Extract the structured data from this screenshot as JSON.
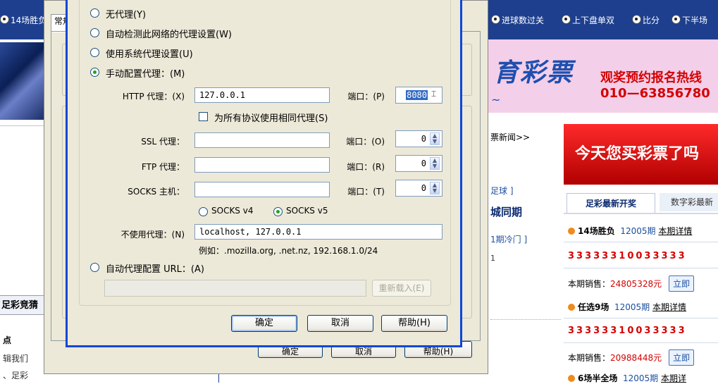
{
  "background_page": {
    "top_nav": [
      {
        "label": "14场胜负"
      },
      {
        "label": "进球数过关"
      },
      {
        "label": "上下盘单双"
      },
      {
        "label": "比分"
      },
      {
        "label": "下半场"
      }
    ],
    "banner": {
      "title": "育彩票",
      "promo": "观奖预约报名热线",
      "phone": "010—63856780",
      "tilde": "~"
    },
    "red_banner_text": "今天您买彩票了吗",
    "news": {
      "more_link": "票新闻>>",
      "tag": "足球 ]",
      "headline": "城同期",
      "tag2": "1期冷门 ]",
      "one": "1"
    },
    "left_column": {
      "heading": "足彩竞猜",
      "sub": "点",
      "text1": "辑我们",
      "text2": "、足彩"
    },
    "lottery_panel": {
      "tab_active": "足彩最新开奖",
      "tab_other": "数字彩最新",
      "items": [
        {
          "name": "14场胜负",
          "period": "12005期",
          "detail": "本期详情",
          "numbers": "33333310033333",
          "sales_label": "本期销售：",
          "sales_value": "24805328元",
          "buy": "立即"
        },
        {
          "name": "任选9场",
          "period": "12005期",
          "detail": "本期详情",
          "numbers": "33333310033333",
          "sales_label": "本期销售：",
          "sales_value": "20988448元",
          "buy": "立即"
        },
        {
          "name": "6场半全场",
          "period": "12005期",
          "detail": "本期详"
        }
      ]
    }
  },
  "options_window": {
    "tab_label": "常规",
    "buttons": {
      "ok": "确定",
      "cancel": "取消",
      "help": "帮助(H)"
    }
  },
  "proxy_dialog": {
    "modes": [
      {
        "label": "无代理(Y)",
        "selected": false
      },
      {
        "label": "自动检测此网络的代理设置(W)",
        "selected": false
      },
      {
        "label": "使用系统代理设置(U)",
        "selected": false
      },
      {
        "label": "手动配置代理：(M)",
        "selected": true
      }
    ],
    "http": {
      "label": "HTTP 代理：(X)",
      "value": "127.0.0.1",
      "port_label": "端口：(P)",
      "port": "8080"
    },
    "share_all": {
      "label": "为所有协议使用相同代理(S)",
      "checked": false
    },
    "ssl": {
      "label": "SSL 代理：",
      "value": "",
      "port_label": "端口：(O)",
      "port": "0"
    },
    "ftp": {
      "label": "FTP 代理：",
      "value": "",
      "port_label": "端口：(R)",
      "port": "0"
    },
    "socks": {
      "label": "SOCKS 主机：",
      "value": "",
      "port_label": "端口：(T)",
      "port": "0"
    },
    "socks_versions": [
      {
        "label": "SOCKS v4",
        "selected": false
      },
      {
        "label": "SOCKS v5",
        "selected": true
      }
    ],
    "no_proxy": {
      "label": "不使用代理：(N)",
      "value": "localhost, 127.0.0.1",
      "example": "例如：.mozilla.org, .net.nz, 192.168.1.0/24"
    },
    "auto_url": {
      "label": "自动代理配置 URL：(A)",
      "value": "",
      "reload": "重新载入(E)",
      "selected": false
    },
    "buttons": {
      "ok": "确定",
      "cancel": "取消",
      "help": "帮助(H)"
    }
  }
}
